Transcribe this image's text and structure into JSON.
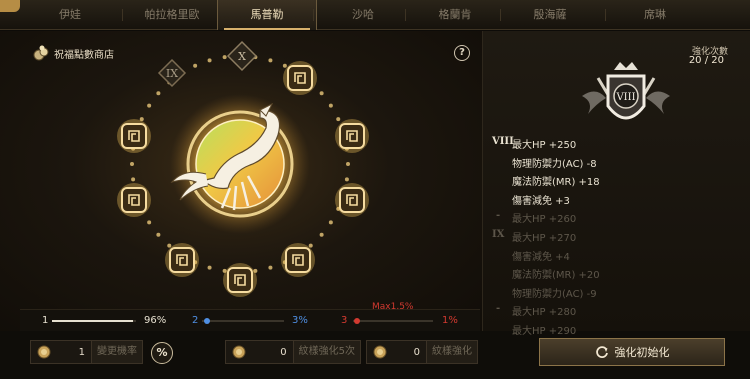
{
  "tabs": [
    {
      "label": "伊娃",
      "active": false
    },
    {
      "label": "帕拉格里歐",
      "active": false
    },
    {
      "label": "馬普勒",
      "active": true
    },
    {
      "label": "沙哈",
      "active": false
    },
    {
      "label": "格蘭肯",
      "active": false
    },
    {
      "label": "殷海薩",
      "active": false
    },
    {
      "label": "席琳",
      "active": false
    }
  ],
  "left_panel": {
    "shop_label": "祝福點數商店",
    "help_label": "?",
    "ring_labels": {
      "prev": "IX",
      "next": "X"
    },
    "zodiac": "scorpio"
  },
  "progress": [
    {
      "num": "1",
      "pct": "96%",
      "fraction": 0.96,
      "color": "#e6e0d0"
    },
    {
      "num": "2",
      "pct": "3%",
      "fraction": 0.03,
      "color": "#4f8fe3"
    },
    {
      "num": "3",
      "pct": "1%",
      "fraction": 0.01,
      "color": "#d33a30"
    }
  ],
  "max_note": "Max1.5%",
  "bottom": {
    "change_prob": {
      "qty": "1",
      "label": "變更機率"
    },
    "pct_button": "%",
    "enhance5": {
      "qty": "0",
      "label": "紋樣強化5次"
    },
    "enhance": {
      "qty": "0",
      "label": "紋樣強化"
    },
    "reset_label": "強化初始化"
  },
  "right_panel": {
    "enh_label": "強化次數",
    "enh_count": "20 / 20",
    "emblem_numeral": "VIII",
    "stats": [
      {
        "roman": "VIII",
        "text": "最大HP +250",
        "dim": false
      },
      {
        "roman": "",
        "text": "物理防禦力(AC) -8",
        "dim": false
      },
      {
        "roman": "",
        "text": "魔法防禦(MR) +18",
        "dim": false
      },
      {
        "roman": "",
        "text": "傷害減免 +3",
        "dim": false
      },
      {
        "roman": "-",
        "text": "最大HP +260",
        "dim": true
      },
      {
        "roman": "IX",
        "text": "最大HP +270",
        "dim": true
      },
      {
        "roman": "",
        "text": "傷害減免 +4",
        "dim": true
      },
      {
        "roman": "",
        "text": "魔法防禦(MR) +20",
        "dim": true
      },
      {
        "roman": "",
        "text": "物理防禦力(AC) -9",
        "dim": true
      },
      {
        "roman": "-",
        "text": "最大HP +280",
        "dim": true
      },
      {
        "roman": "",
        "text": "最大HP +290",
        "dim": true
      }
    ]
  },
  "colors": {
    "gold": "#d6b06c",
    "blue": "#4f8fe3",
    "red": "#d33a30"
  }
}
